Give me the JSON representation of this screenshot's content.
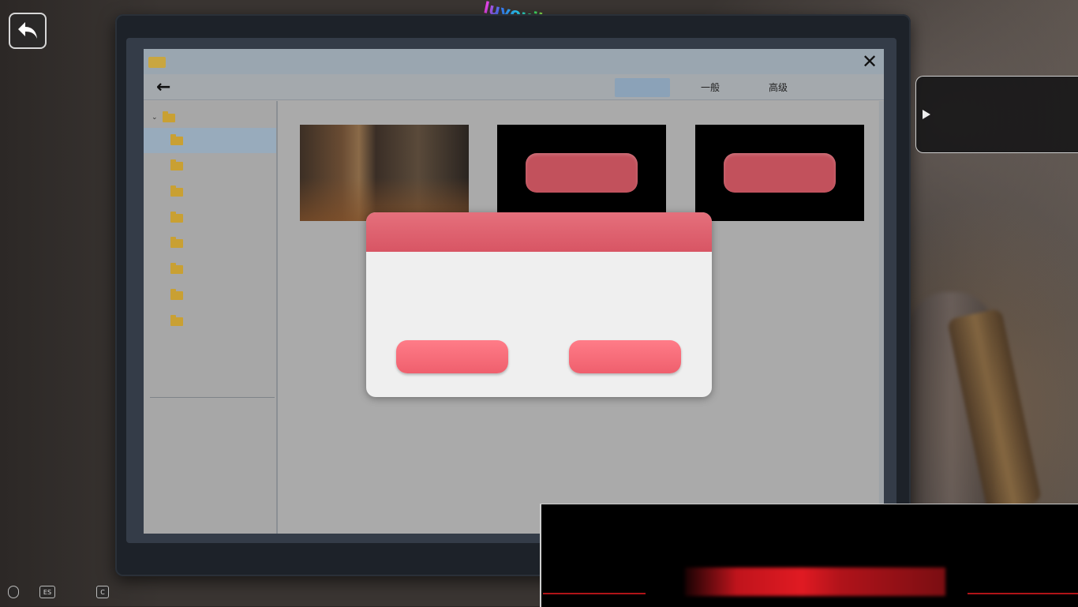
{
  "watermark": "luyouji.cc",
  "window": {
    "toolbar": {
      "tabs": [
        {
          "label": ""
        },
        {
          "label": "一般"
        },
        {
          "label": "高级"
        },
        {
          "label": ""
        }
      ]
    },
    "sidebar": {
      "items": [
        {
          "label": ""
        },
        {
          "label": ""
        },
        {
          "label": ""
        },
        {
          "label": ""
        },
        {
          "label": ""
        },
        {
          "label": ""
        },
        {
          "label": ""
        },
        {
          "label": ""
        }
      ]
    }
  },
  "dialog": {
    "message": "",
    "left_button": "",
    "right_button": ""
  },
  "bottom_bar": {
    "keys": [
      "",
      "ES",
      "C"
    ]
  }
}
